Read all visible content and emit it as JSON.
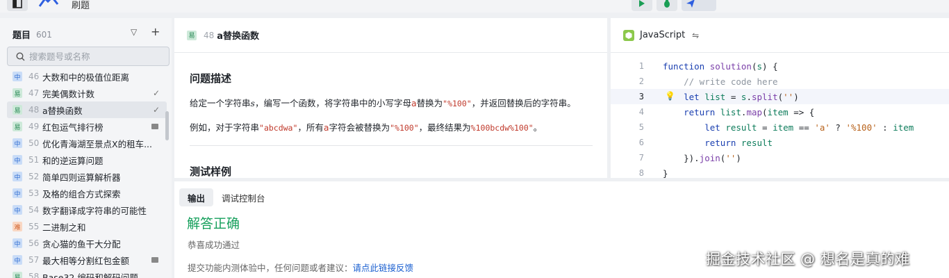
{
  "header": {
    "title": "刷题"
  },
  "sidebar": {
    "title": "题目",
    "count": "601",
    "search_placeholder": "搜索题号或名称",
    "items": [
      {
        "diff": "中",
        "num": "46",
        "name": "大数和中的极值位距离",
        "status": "",
        "active": false
      },
      {
        "diff": "易",
        "num": "47",
        "name": "完美偶数计数",
        "status": "✓",
        "active": false
      },
      {
        "diff": "易",
        "num": "48",
        "name": "a替换函数",
        "status": "✓",
        "active": true
      },
      {
        "diff": "易",
        "num": "49",
        "name": "红包运气排行榜",
        "status": "box",
        "active": false
      },
      {
        "diff": "中",
        "num": "50",
        "name": "优化青海湖至景点X的租车...",
        "status": "",
        "active": false
      },
      {
        "diff": "中",
        "num": "51",
        "name": "和的逆运算问题",
        "status": "",
        "active": false
      },
      {
        "diff": "中",
        "num": "52",
        "name": "简单四则运算解析器",
        "status": "",
        "active": false
      },
      {
        "diff": "中",
        "num": "53",
        "name": "及格的组合方式探索",
        "status": "",
        "active": false
      },
      {
        "diff": "中",
        "num": "54",
        "name": "数字翻译成字符串的可能性",
        "status": "",
        "active": false
      },
      {
        "diff": "难",
        "num": "55",
        "name": "二进制之和",
        "status": "",
        "active": false
      },
      {
        "diff": "中",
        "num": "56",
        "name": "贪心猫的鱼干大分配",
        "status": "",
        "active": false
      },
      {
        "diff": "中",
        "num": "57",
        "name": "最大相等分割红包金额",
        "status": "box",
        "active": false
      },
      {
        "diff": "易",
        "num": "58",
        "name": "Base32 编码和解码问题",
        "status": "",
        "active": false
      }
    ]
  },
  "problem": {
    "difficulty": "易",
    "number": "48",
    "title": "a替换函数",
    "desc_heading": "问题描述",
    "para1": {
      "a": "给定一个字符串",
      "var": "s",
      "b": "，编写一个函数，将字符串中的小写字母",
      "letter": "a",
      "c": "替换为",
      "code": "\"%100\"",
      "d": "，并返回替换后的字符串。"
    },
    "para2": {
      "a": "例如，对于字符串",
      "code1": "\"abcdwa\"",
      "b": "，所有",
      "letter": "a",
      "c": "字符会被替换为",
      "code2": "\"%100\"",
      "d": "，最终结果为",
      "code3": "%100bcdw%100\"",
      "e": "。"
    },
    "test_heading": "测试样例"
  },
  "editor": {
    "language": "JavaScript",
    "line_numbers": [
      "1",
      "2",
      "3",
      "4",
      "5",
      "6",
      "7",
      "8"
    ],
    "highlighted_line": "3"
  },
  "output": {
    "tabs": [
      "输出",
      "调试控制台"
    ],
    "result": "解答正确",
    "result_sub": "恭喜成功通过",
    "feedback_prefix": "提交功能内测体验中，任何问题或者建议：",
    "feedback_link": "请点此链接反馈"
  },
  "watermark": "掘金技术社区 @ 想名是真的难",
  "colors": {
    "success": "#17a05d",
    "link": "#1a5fd0",
    "accent": "#c0392b"
  }
}
